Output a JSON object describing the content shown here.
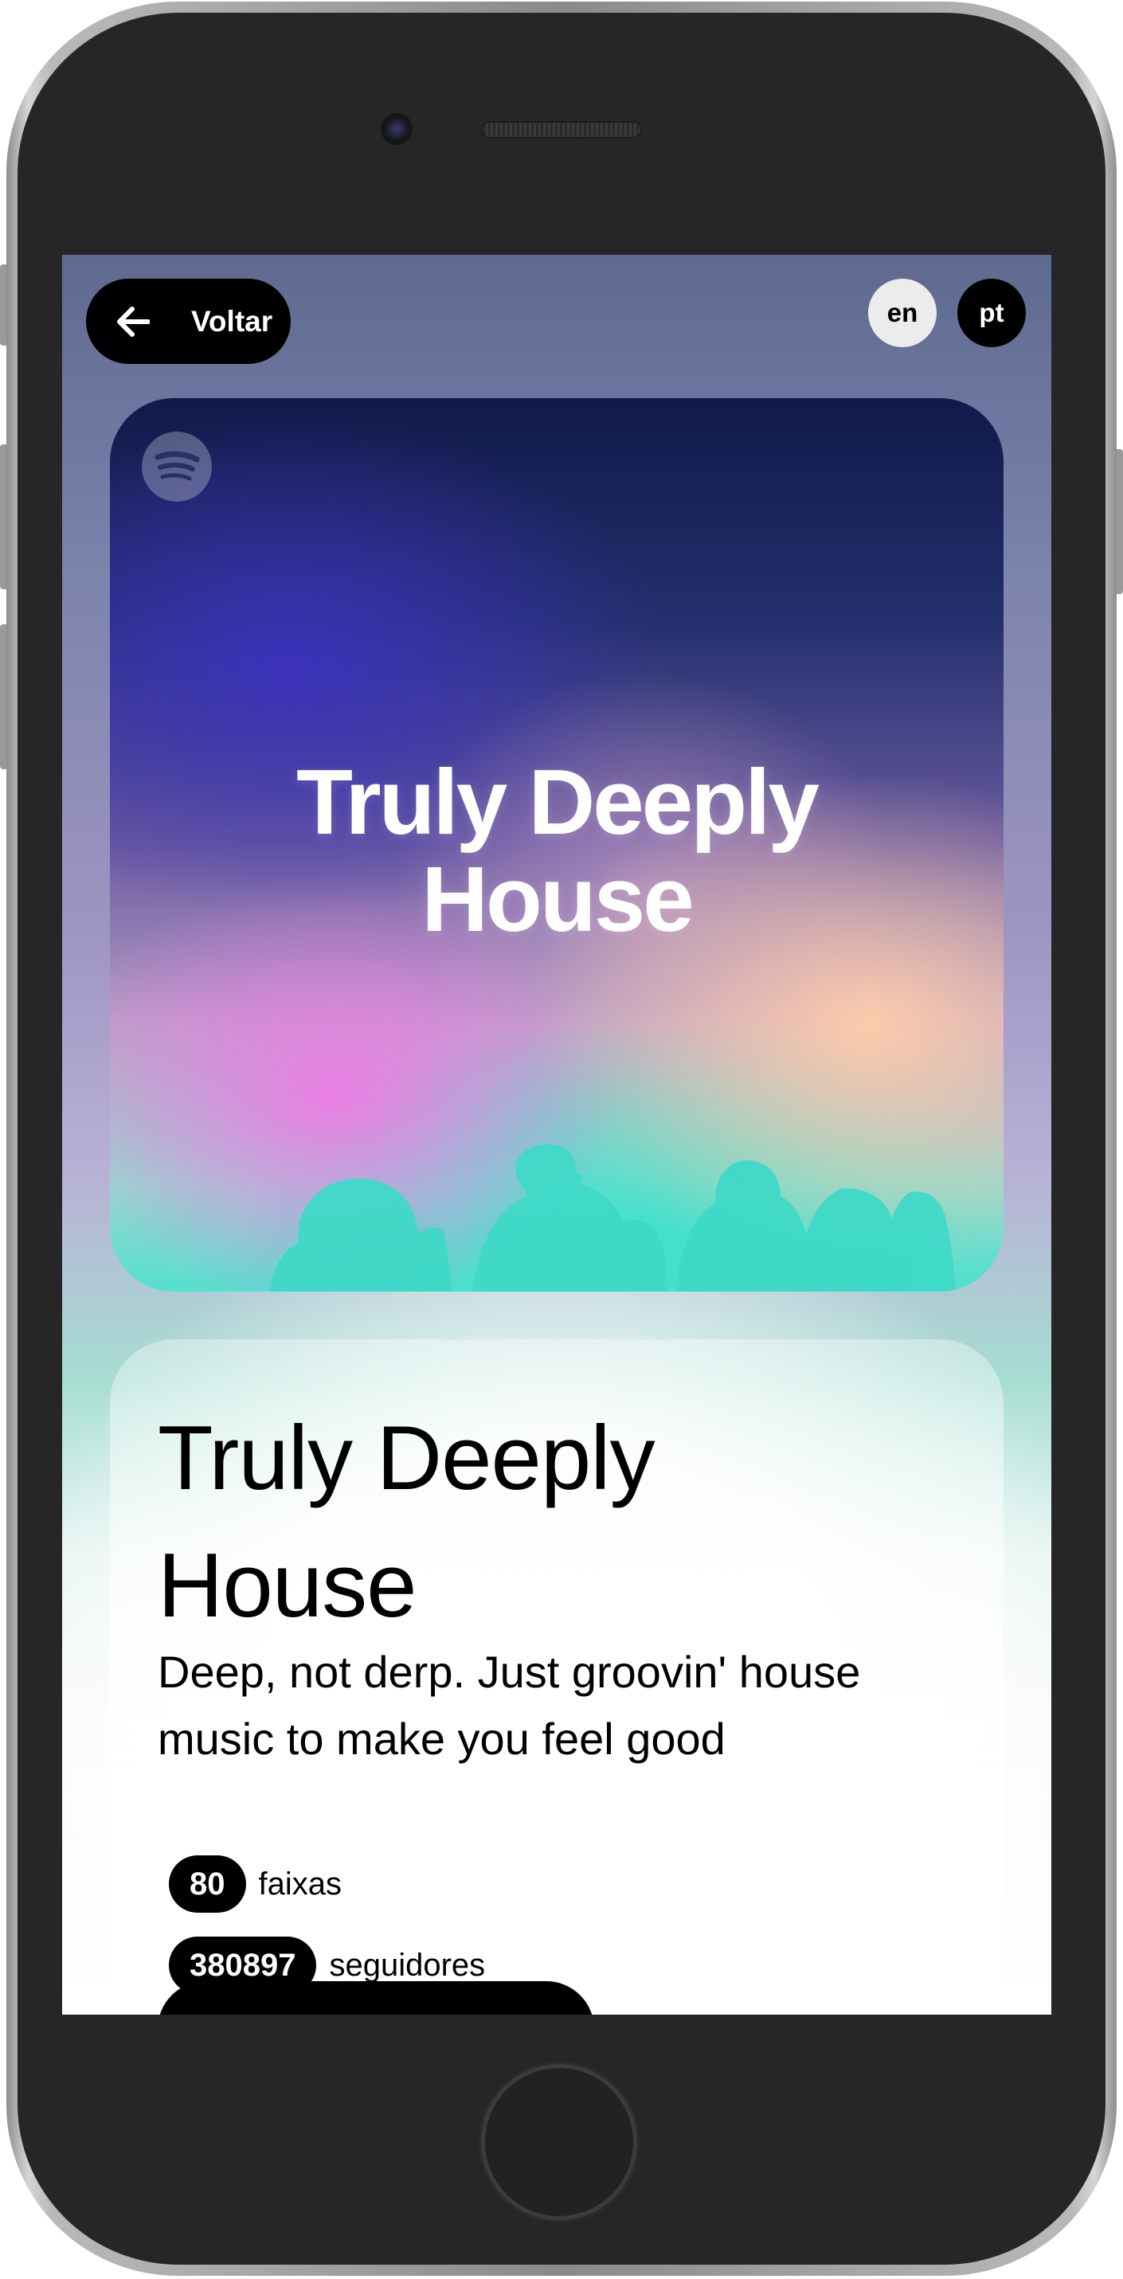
{
  "header": {
    "back_label": "Voltar",
    "languages": [
      "en",
      "pt"
    ]
  },
  "cover": {
    "title_line1": "Truly Deeply",
    "title_line2": "House"
  },
  "playlist": {
    "title": "Truly Deeply House",
    "description": "Deep, not derp. Just groovin' house music to make you feel good",
    "tracks_count": "80",
    "tracks_label": "faixas",
    "followers_count": "380897",
    "followers_label": "seguidores"
  },
  "colors": {
    "button_bg": "#000000",
    "lang_inactive_bg": "#ececec",
    "accent_teal": "#3ee0cf"
  }
}
